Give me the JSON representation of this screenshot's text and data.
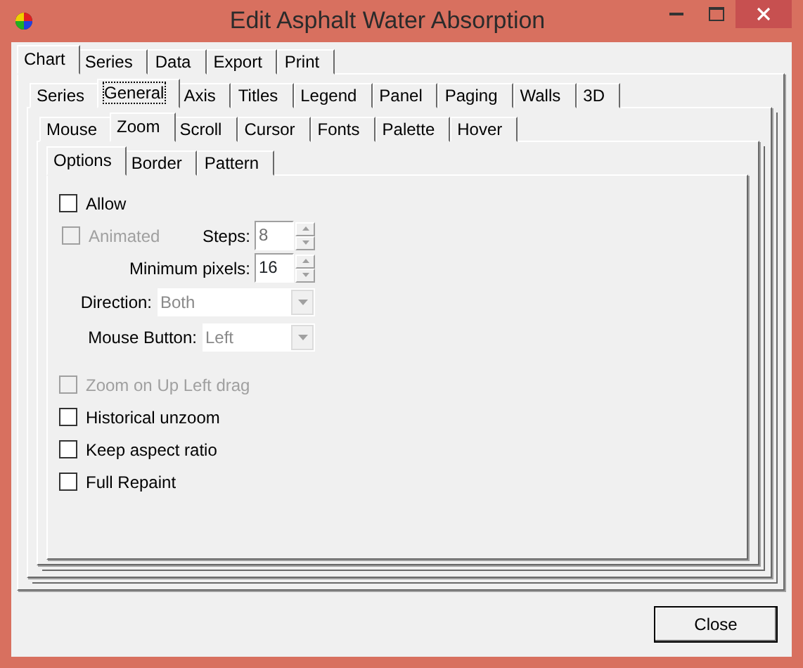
{
  "window": {
    "title": "Edit Asphalt Water Absorption"
  },
  "tab_levels": [
    {
      "tabs": [
        {
          "label": "Chart",
          "selected": true
        },
        {
          "label": "Series",
          "selected": false
        },
        {
          "label": "Data",
          "selected": false
        },
        {
          "label": "Export",
          "selected": false
        },
        {
          "label": "Print",
          "selected": false
        }
      ]
    },
    {
      "tabs": [
        {
          "label": "Series",
          "selected": false
        },
        {
          "label": "General",
          "selected": true
        },
        {
          "label": "Axis",
          "selected": false
        },
        {
          "label": "Titles",
          "selected": false
        },
        {
          "label": "Legend",
          "selected": false
        },
        {
          "label": "Panel",
          "selected": false
        },
        {
          "label": "Paging",
          "selected": false
        },
        {
          "label": "Walls",
          "selected": false
        },
        {
          "label": "3D",
          "selected": false
        }
      ]
    },
    {
      "tabs": [
        {
          "label": "Mouse",
          "selected": false
        },
        {
          "label": "Zoom",
          "selected": true
        },
        {
          "label": "Scroll",
          "selected": false
        },
        {
          "label": "Cursor",
          "selected": false
        },
        {
          "label": "Fonts",
          "selected": false
        },
        {
          "label": "Palette",
          "selected": false
        },
        {
          "label": "Hover",
          "selected": false
        }
      ]
    },
    {
      "tabs": [
        {
          "label": "Options",
          "selected": true
        },
        {
          "label": "Border",
          "selected": false
        },
        {
          "label": "Pattern",
          "selected": false
        }
      ]
    }
  ],
  "options": [
    {
      "kind": "checkbox",
      "label": "Allow",
      "checked": false,
      "disabled": false
    },
    {
      "kind": "checkbox_spin",
      "label": "Animated",
      "checked": false,
      "disabled": true,
      "spin": {
        "label": "Steps:",
        "value": "8",
        "disabled": true
      }
    },
    {
      "kind": "spin",
      "label": "Minimum pixels:",
      "value": "16",
      "disabled": false
    },
    {
      "kind": "dropdown",
      "label": "Direction:",
      "value": "Both",
      "disabled": true
    },
    {
      "kind": "dropdown",
      "label": "Mouse Button:",
      "value": "Left",
      "disabled": true
    },
    {
      "kind": "checkbox",
      "label": "Zoom on Up Left drag",
      "checked": false,
      "disabled": true
    },
    {
      "kind": "checkbox",
      "label": "Historical unzoom",
      "checked": false,
      "disabled": false
    },
    {
      "kind": "checkbox",
      "label": "Keep aspect ratio",
      "checked": false,
      "disabled": false
    },
    {
      "kind": "checkbox",
      "label": "Full Repaint",
      "checked": false,
      "disabled": false
    }
  ],
  "buttons": [
    {
      "label": "Close"
    }
  ]
}
